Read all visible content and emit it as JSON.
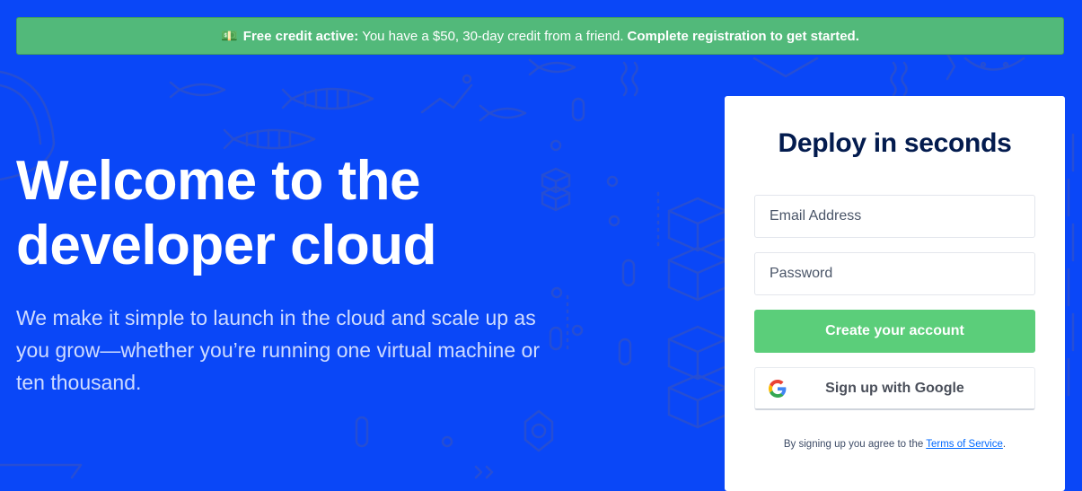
{
  "banner": {
    "icon": "money-icon",
    "lead": "Free credit active:",
    "message": "You have a $50, 30-day credit from a friend.",
    "cta": "Complete registration to get started."
  },
  "hero": {
    "title_line1": "Welcome to the",
    "title_line2": "developer cloud",
    "subtitle": "We make it simple to launch in the cloud and scale up as you grow—whether you’re running one virtual machine or ten thousand."
  },
  "signup": {
    "heading": "Deploy in seconds",
    "email_placeholder": "Email Address",
    "password_placeholder": "Password",
    "create_label": "Create your account",
    "google_label": "Sign up with Google",
    "terms_prefix": "By signing up you agree to the",
    "terms_link": "Terms of Service",
    "terms_suffix": "."
  },
  "colors": {
    "background": "#0a47f7",
    "banner": "#52b97a",
    "create_button": "#5bce7a",
    "heading": "#031b4e",
    "link": "#0069ff"
  }
}
